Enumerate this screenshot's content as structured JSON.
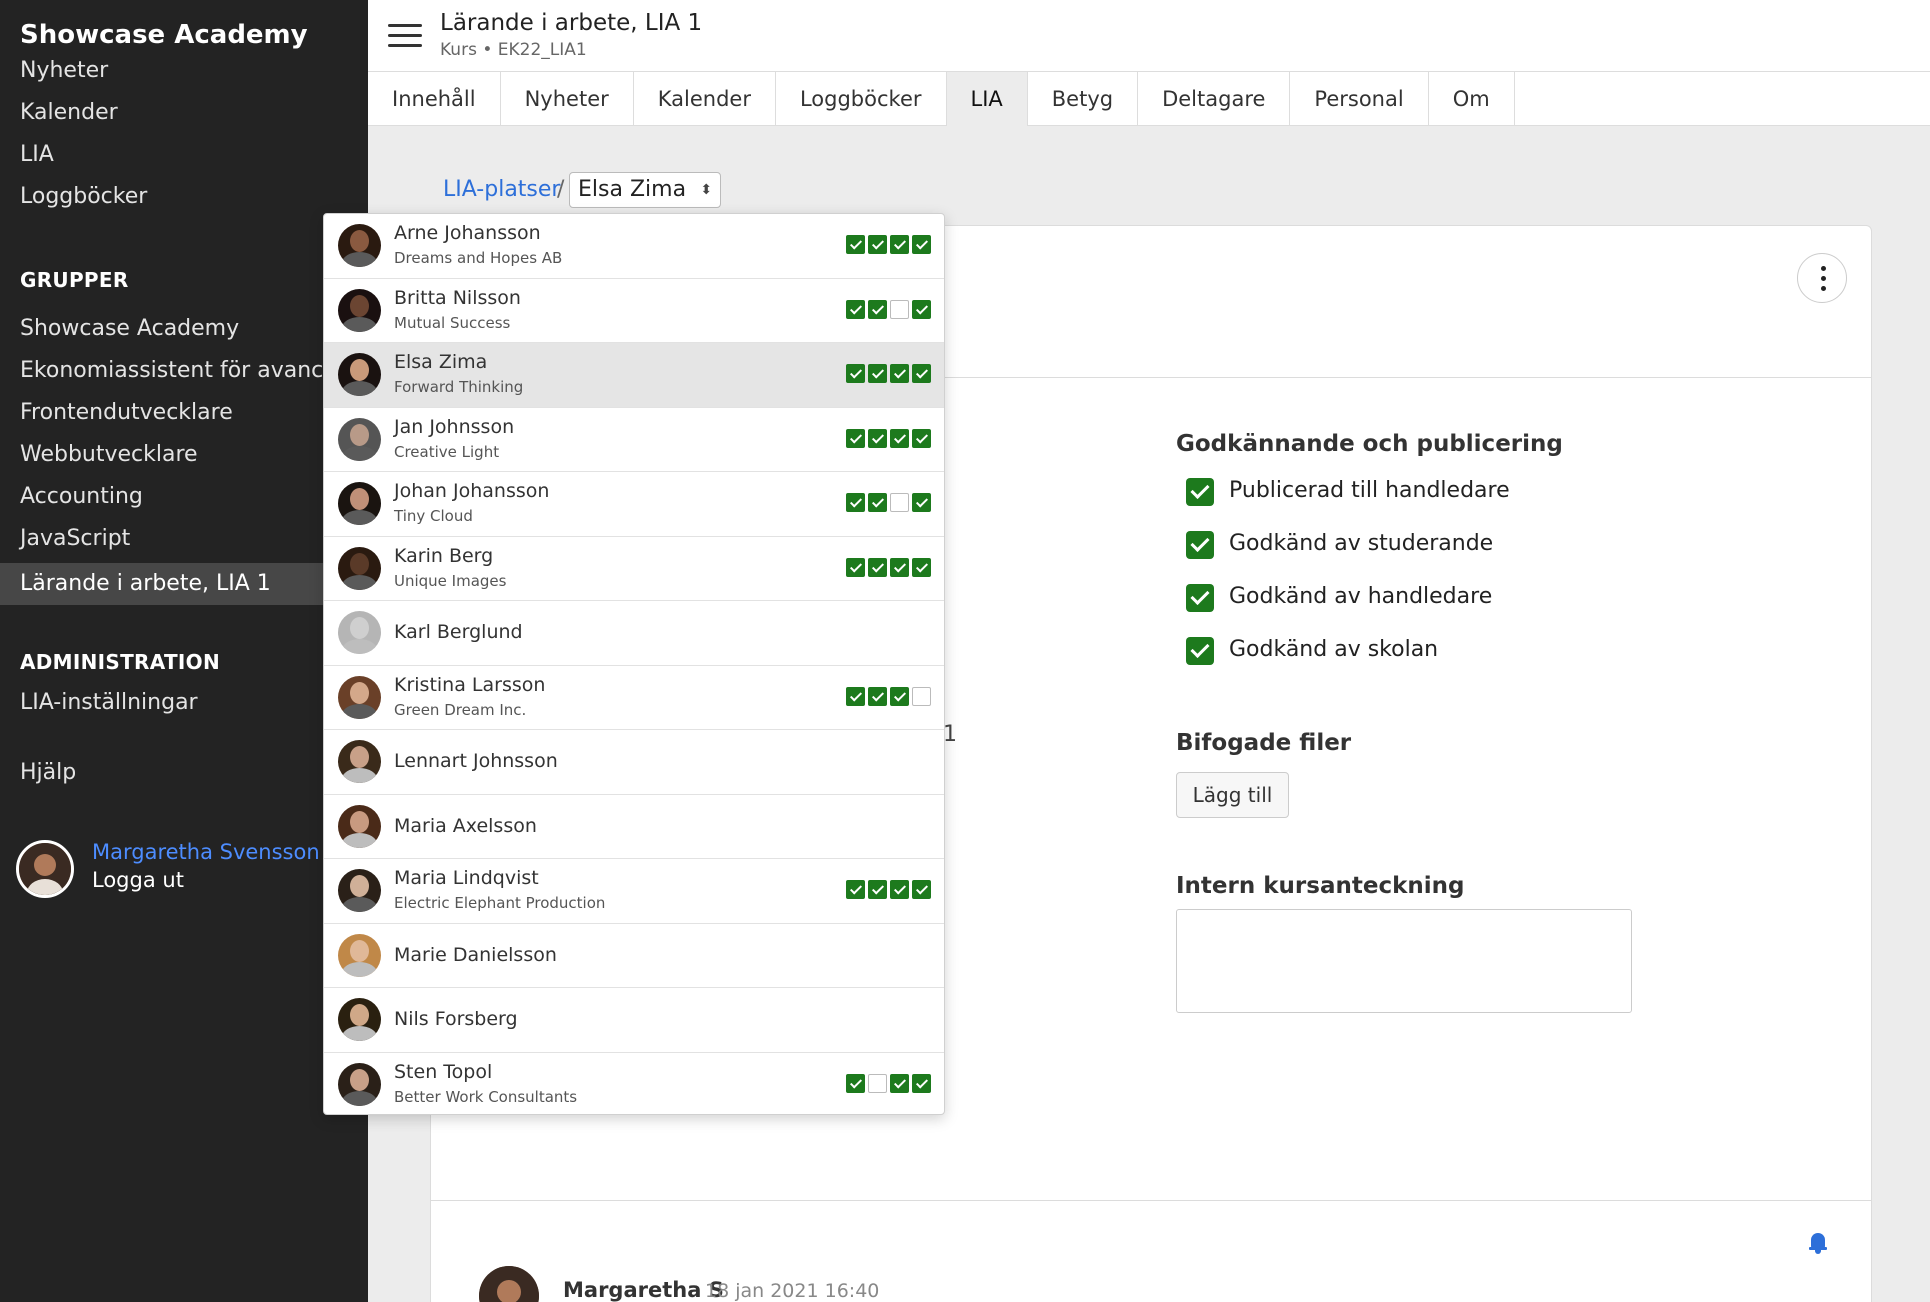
{
  "sidebar": {
    "brand": "Showcase Academy",
    "top_items": [
      {
        "label": "Nyheter"
      },
      {
        "label": "Kalender"
      },
      {
        "label": "LIA"
      },
      {
        "label": "Loggböcker"
      }
    ],
    "groups_heading": "GRUPPER",
    "groups": [
      {
        "label": "Showcase Academy"
      },
      {
        "label": "Ekonomiassistent för avancerad"
      },
      {
        "label": "Frontendutvecklare"
      },
      {
        "label": "Webbutvecklare"
      },
      {
        "label": "Accounting"
      },
      {
        "label": "JavaScript"
      },
      {
        "label": "Lärande i arbete, LIA 1",
        "active": true
      }
    ],
    "admin_heading": "ADMINISTRATION",
    "admin_items": [
      {
        "label": "LIA-inställningar"
      }
    ],
    "help": "Hjälp",
    "user": {
      "name": "Margaretha Svensson",
      "logout": "Logga ut"
    }
  },
  "header": {
    "title": "Lärande i arbete, LIA 1",
    "subtitle": "Kurs • EK22_LIA1"
  },
  "tabs": [
    {
      "label": "Innehåll"
    },
    {
      "label": "Nyheter"
    },
    {
      "label": "Kalender"
    },
    {
      "label": "Loggböcker"
    },
    {
      "label": "LIA",
      "active": true
    },
    {
      "label": "Betyg"
    },
    {
      "label": "Deltagare"
    },
    {
      "label": "Personal"
    },
    {
      "label": "Om"
    }
  ],
  "breadcrumb": {
    "link": "LIA-platser",
    "separator": "/",
    "selected": "Elsa Zima"
  },
  "approval": {
    "title": "Godkännande och publicering",
    "items": [
      {
        "label": "Publicerad till handledare",
        "checked": true
      },
      {
        "label": "Godkänd av studerande",
        "checked": true
      },
      {
        "label": "Godkänd av handledare",
        "checked": true
      },
      {
        "label": "Godkänd av skolan",
        "checked": true
      }
    ]
  },
  "attachments": {
    "title": "Bifogade filer",
    "add_label": "Lägg till"
  },
  "internal_note": {
    "title": "Intern kursanteckning",
    "value": ""
  },
  "stray_text": "1",
  "comment": {
    "author": "Margaretha S",
    "date": "18 jan 2021 16:40"
  },
  "students": [
    {
      "name": "Arne Johansson",
      "company": "Dreams and Hopes AB",
      "status": [
        true,
        true,
        true,
        true
      ],
      "skin": "#8a5a40",
      "hair": "#2a1a10"
    },
    {
      "name": "Britta Nilsson",
      "company": "Mutual Success",
      "status": [
        true,
        true,
        false,
        true
      ],
      "skin": "#6b4532",
      "hair": "#1a1010"
    },
    {
      "name": "Elsa Zima",
      "company": "Forward Thinking",
      "status": [
        true,
        true,
        true,
        true
      ],
      "skin": "#c99a7a",
      "hair": "#1a1210",
      "selected": true
    },
    {
      "name": "Jan Johnsson",
      "company": "Creative Light",
      "status": [
        true,
        true,
        true,
        true
      ],
      "skin": "#b89a88",
      "hair": "#555555"
    },
    {
      "name": "Johan Johansson",
      "company": "Tiny Cloud",
      "status": [
        true,
        true,
        false,
        true
      ],
      "skin": "#c09078",
      "hair": "#1a1410"
    },
    {
      "name": "Karin Berg",
      "company": "Unique Images",
      "status": [
        true,
        true,
        true,
        true
      ],
      "skin": "#5a3a28",
      "hair": "#2a1a10"
    },
    {
      "name": "Karl Berglund",
      "company": "",
      "status": [],
      "skin": "#cfcfcf",
      "hair": "#b5b5b5"
    },
    {
      "name": "Kristina Larsson",
      "company": "Green Dream Inc.",
      "status": [
        true,
        true,
        true,
        false
      ],
      "skin": "#d4a88a",
      "hair": "#6a4028"
    },
    {
      "name": "Lennart Johnsson",
      "company": "",
      "status": [],
      "skin": "#c8a088",
      "hair": "#3a2a1a"
    },
    {
      "name": "Maria Axelsson",
      "company": "",
      "status": [],
      "skin": "#c89a80",
      "hair": "#4a2a18"
    },
    {
      "name": "Maria Lindqvist",
      "company": "Electric Elephant Production",
      "status": [
        true,
        true,
        true,
        true
      ],
      "skin": "#d0b098",
      "hair": "#2a2018"
    },
    {
      "name": "Marie Danielsson",
      "company": "",
      "status": [],
      "skin": "#e0b898",
      "hair": "#c08848"
    },
    {
      "name": "Nils Forsberg",
      "company": "",
      "status": [],
      "skin": "#d0a888",
      "hair": "#2a2010"
    },
    {
      "name": "Sten Topol",
      "company": "Better Work Consultants",
      "status": [
        true,
        false,
        true,
        true
      ],
      "skin": "#c8a088",
      "hair": "#2a2018"
    }
  ],
  "colors": {
    "sidebar_bg": "#232323",
    "accent_link": "#2d6fd9",
    "check_green": "#1d7a1d",
    "user_link": "#4d8dff"
  },
  "icons": [
    "hamburger-icon",
    "kebab-icon",
    "bell-icon",
    "check-icon",
    "select-caret-icon"
  ]
}
